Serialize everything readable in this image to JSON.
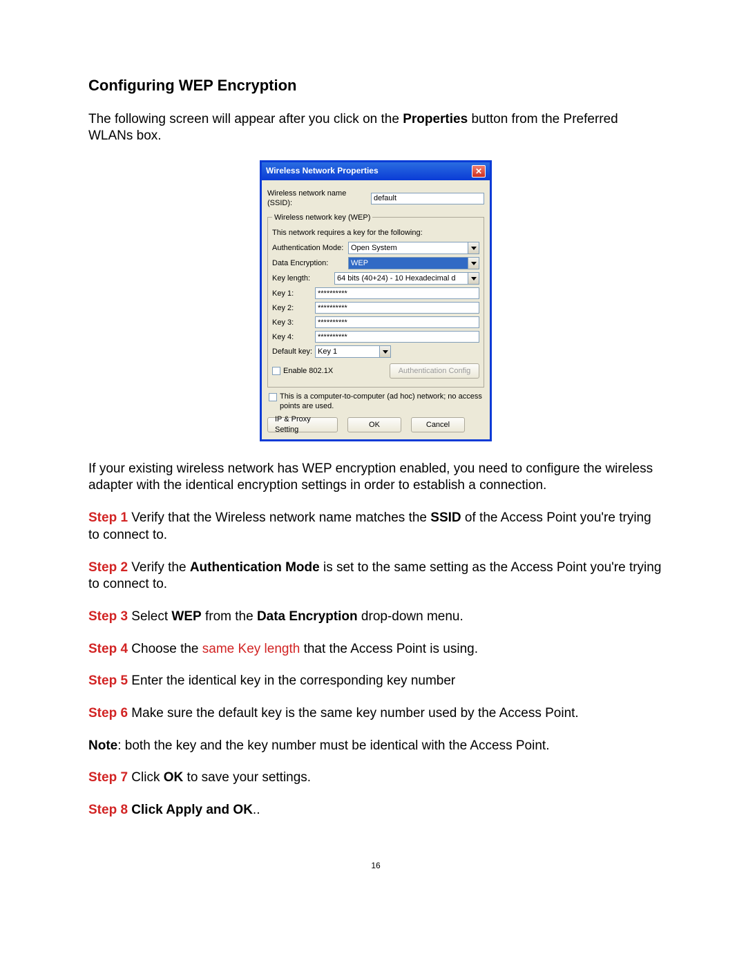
{
  "title": "Configuring WEP Encryption",
  "intro_pre": "The following screen will appear after you click on the ",
  "intro_bold": "Properties",
  "intro_post": " button from the Preferred WLANs box.",
  "dialog": {
    "title": "Wireless Network Properties",
    "ssid_label": "Wireless network name (SSID):",
    "ssid_value": "default",
    "group_legend": "Wireless network key (WEP)",
    "group_desc": "This network requires a key for the following:",
    "auth_label": "Authentication Mode:",
    "auth_value": "Open System",
    "enc_label": "Data Encryption:",
    "enc_value": "WEP",
    "keylen_label": "Key length:",
    "keylen_value": "64 bits (40+24) - 10 Hexadecimal d",
    "key1_label": "Key 1:",
    "key1_value": "**********",
    "key2_label": "Key 2:",
    "key2_value": "**********",
    "key3_label": "Key 3:",
    "key3_value": "**********",
    "key4_label": "Key 4:",
    "key4_value": "**********",
    "defkey_label": "Default key:",
    "defkey_value": "Key 1",
    "enable8021x": "Enable 802.1X",
    "authconfig_btn": "Authentication Config",
    "adhoc_text": "This is a computer-to-computer (ad hoc) network; no access points are used.",
    "ipproxy_btn": "IP & Proxy Setting",
    "ok_btn": "OK",
    "cancel_btn": "Cancel"
  },
  "para2": "If your existing wireless network has WEP encryption enabled, you need to configure the wireless adapter with the identical encryption settings in order to establish a connection.",
  "steps": {
    "s1_label": "Step 1",
    "s1_a": " Verify that the Wireless network name matches the ",
    "s1_b": "SSID",
    "s1_c": " of the Access Point you're trying to connect to.",
    "s2_label": "Step 2",
    "s2_a": " Verify the ",
    "s2_b": "Authentication Mode",
    "s2_c": " is set to the same setting as the Access Point you're trying to connect to.",
    "s3_label": "Step 3",
    "s3_a": " Select ",
    "s3_b": "WEP",
    "s3_c": " from the ",
    "s3_d": "Data Encryption",
    "s3_e": " drop-down menu.",
    "s4_label": "Step 4",
    "s4_a": " Choose the ",
    "s4_b": "same Key length",
    "s4_c": " that the Access Point is using.",
    "s5_label": "Step 5",
    "s5_a": " Enter the identical key in the corresponding key number",
    "s6_label": "Step 6",
    "s6_a": " Make sure the default key is the same key number used by the Access Point.",
    "note_label": "Note",
    "note_a": ": both the key and the key number must be identical with the Access Point.",
    "s7_label": "Step 7",
    "s7_a": " Click ",
    "s7_b": "OK",
    "s7_c": " to save your settings.",
    "s8_label": "Step 8",
    "s8_a": " Click ",
    "s8_b": "Apply",
    "s8_c": " and ",
    "s8_d": "OK",
    "s8_e": ".."
  },
  "page_number": "16"
}
